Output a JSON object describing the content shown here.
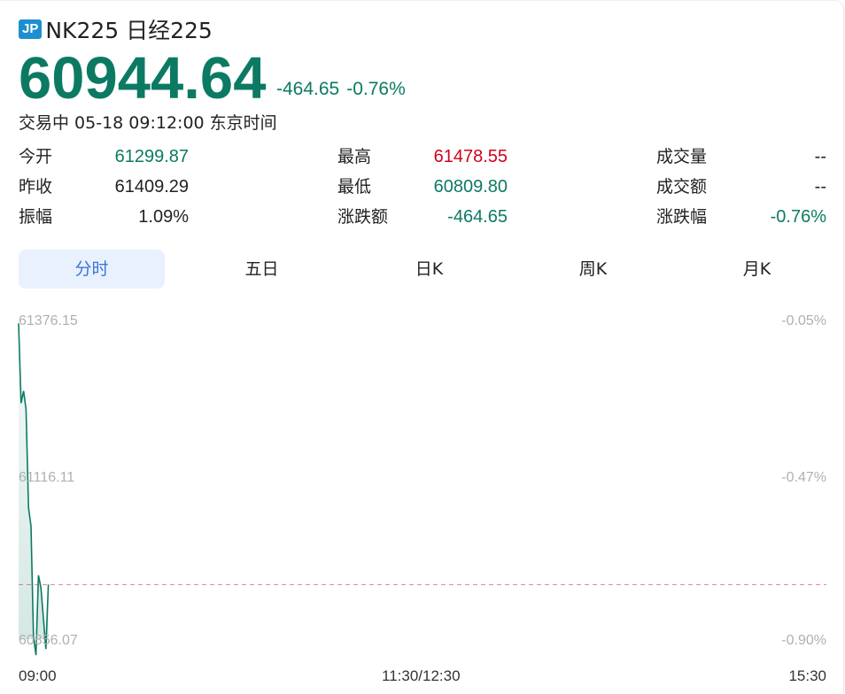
{
  "header": {
    "badge": "JP",
    "name": "NK225 日经225",
    "price": "60944.64",
    "change": "-464.65",
    "change_pct": "-0.76%",
    "status": "交易中 05-18 09:12:00 东京时间"
  },
  "stats": {
    "open_label": "今开",
    "open_value": "61299.87",
    "prev_close_label": "昨收",
    "prev_close_value": "61409.29",
    "amplitude_label": "振幅",
    "amplitude_value": "1.09%",
    "high_label": "最高",
    "high_value": "61478.55",
    "low_label": "最低",
    "low_value": "60809.80",
    "chg_label": "涨跌额",
    "chg_value": "-464.65",
    "volume_label": "成交量",
    "volume_value": "--",
    "turnover_label": "成交额",
    "turnover_value": "--",
    "chg_pct_label": "涨跌幅",
    "chg_pct_value": "-0.76%"
  },
  "tabs": [
    "分时",
    "五日",
    "日K",
    "周K",
    "月K"
  ],
  "active_tab": 0,
  "colors": {
    "up": "#d0021b",
    "down": "#0c7a63",
    "accent": "#3b74d9",
    "ref_line": "#e88a8a"
  },
  "chart_data": {
    "type": "line",
    "x": [
      "09:00",
      "09:01",
      "09:02",
      "09:03",
      "09:04",
      "09:05",
      "09:06",
      "09:07",
      "09:08",
      "09:09",
      "09:10",
      "09:11",
      "09:12"
    ],
    "values": [
      61370,
      61240,
      61260,
      61230,
      61070,
      61040,
      60860,
      60830,
      60960,
      60940,
      60890,
      60840,
      60945
    ],
    "x_ticks": [
      "09:00",
      "11:30/12:30",
      "15:30"
    ],
    "y_ticks_left": [
      "61376.15",
      "61116.11",
      "60856.07"
    ],
    "y_ticks_right": [
      "-0.05%",
      "-0.47%",
      "-0.90%"
    ],
    "ylim": [
      60856.07,
      61376.15
    ],
    "reference_line": 60944.64
  }
}
